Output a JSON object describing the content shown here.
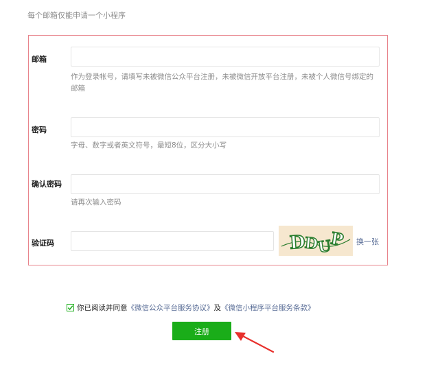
{
  "notice": "每个邮箱仅能申请一个小程序",
  "form": {
    "email": {
      "label": "邮箱",
      "value": "",
      "hint": "作为登录帐号，请填写未被微信公众平台注册，未被微信开放平台注册，未被个人微信号绑定的邮箱"
    },
    "password": {
      "label": "密码",
      "value": "",
      "hint": "字母、数字或者英文符号，最短8位，区分大小写"
    },
    "confirm_password": {
      "label": "确认密码",
      "value": "",
      "hint": "请再次输入密码"
    },
    "captcha": {
      "label": "验证码",
      "value": "",
      "image_text": "DDUP",
      "refresh_label": "换一张"
    }
  },
  "agreement": {
    "checked": true,
    "text_before": "你已阅读并同意",
    "link1": "《微信公众平台服务协议》",
    "joiner": "及",
    "link2": "《微信小程序平台服务条款》"
  },
  "submit_label": "注册",
  "colors": {
    "accent_green": "#1aad19",
    "link_blue": "#576b95",
    "form_border": "#e8848c",
    "hint_gray": "#8d8d8d",
    "arrow_red": "#e8302c"
  }
}
